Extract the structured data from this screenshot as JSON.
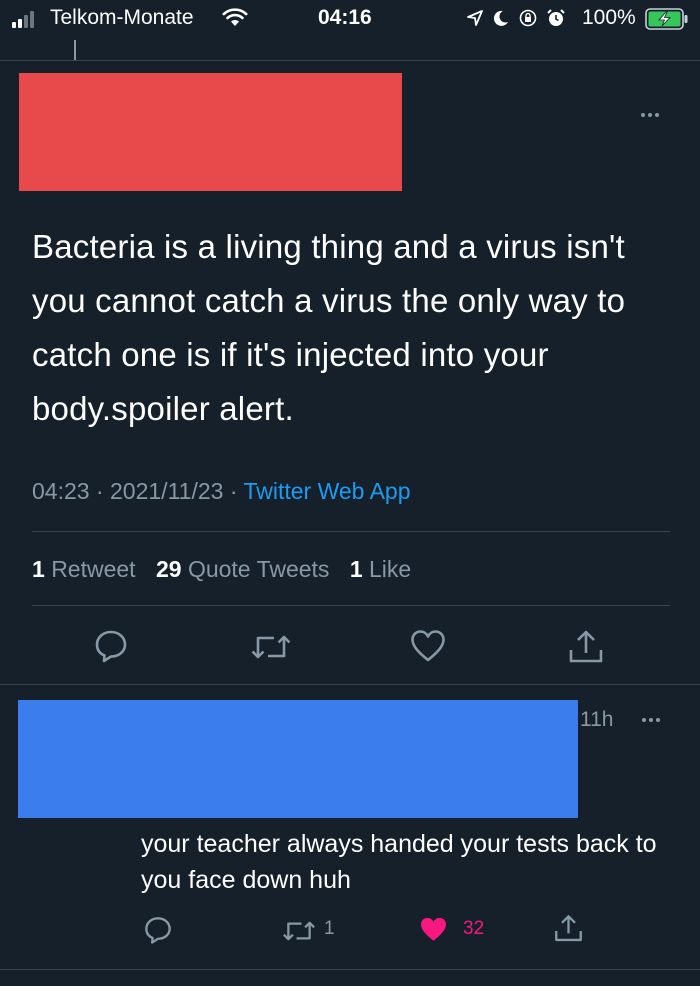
{
  "status_bar": {
    "carrier": "Telkom-Monate",
    "time": "04:16",
    "battery_percent": "100%",
    "signal_bars": 4,
    "signal_bars_filled": 2,
    "icons": [
      "signal-icon",
      "wifi-icon",
      "location-arrow-icon",
      "moon-icon",
      "rotation-lock-icon",
      "alarm-icon",
      "battery-charging-icon"
    ]
  },
  "tweet": {
    "text": "Bacteria is a living thing and a virus isn't you cannot catch a virus the only way to catch one is if it's injected into your body.spoiler alert.",
    "time": "04:23",
    "date": "2021/11/23",
    "separator": "·",
    "source": "Twitter Web App",
    "stats": {
      "retweets_count": "1",
      "retweets_label": "Retweet",
      "quotes_count": "29",
      "quotes_label": "Quote Tweets",
      "likes_count": "1",
      "likes_label": "Like"
    },
    "actions": [
      "reply-icon",
      "retweet-icon",
      "like-icon",
      "share-icon"
    ]
  },
  "reply": {
    "time_ago": "11h",
    "text": "your teacher always handed your tests back to you face down huh",
    "retweet_count": "1",
    "like_count": "32",
    "liked": true
  },
  "colors": {
    "background": "#15202b",
    "muted_text": "#8899a6",
    "link": "#1d9bf0",
    "divider": "#38444d",
    "like": "#f91880",
    "redaction_red": "#e8494b",
    "redaction_blue": "#3b7ded",
    "battery_green": "#35c759"
  }
}
